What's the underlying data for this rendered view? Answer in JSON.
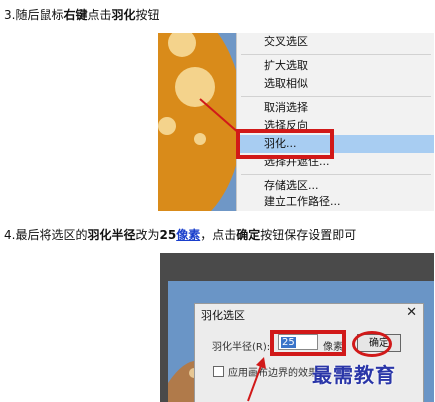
{
  "step3": {
    "prefix": "3.随后鼠标",
    "bold1": "右键",
    "mid": "点击",
    "bold2": "羽化",
    "suffix": "按钮"
  },
  "step4": {
    "prefix": "4.最后将选区的",
    "bold1": "羽化半径",
    "mid1": "改为",
    "bold2": "25",
    "link": "像素",
    "mid2": "，点击",
    "bold3": "确定",
    "suffix": "按钮保存设置即可"
  },
  "context_menu": {
    "items": [
      "交叉选区",
      "扩大选取",
      "选取相似",
      "取消选择",
      "选择反向",
      "羽化...",
      "选择并遮住...",
      "存储选区...",
      "建立工作路径..."
    ],
    "highlighted": "羽化..."
  },
  "feather_dialog": {
    "title": "羽化选区",
    "close": "✕",
    "radius_label": "羽化半径(R):",
    "radius_value": "25",
    "radius_unit": "像素",
    "ok_label": "确定",
    "edge_label": "应用画布边界的效果"
  },
  "watermark": "最需教育",
  "colors": {
    "highlight": "#a8cdf2",
    "annotation_red": "#d11919",
    "link": "#1a3fcc",
    "canvas_blue": "#6f97c6"
  }
}
